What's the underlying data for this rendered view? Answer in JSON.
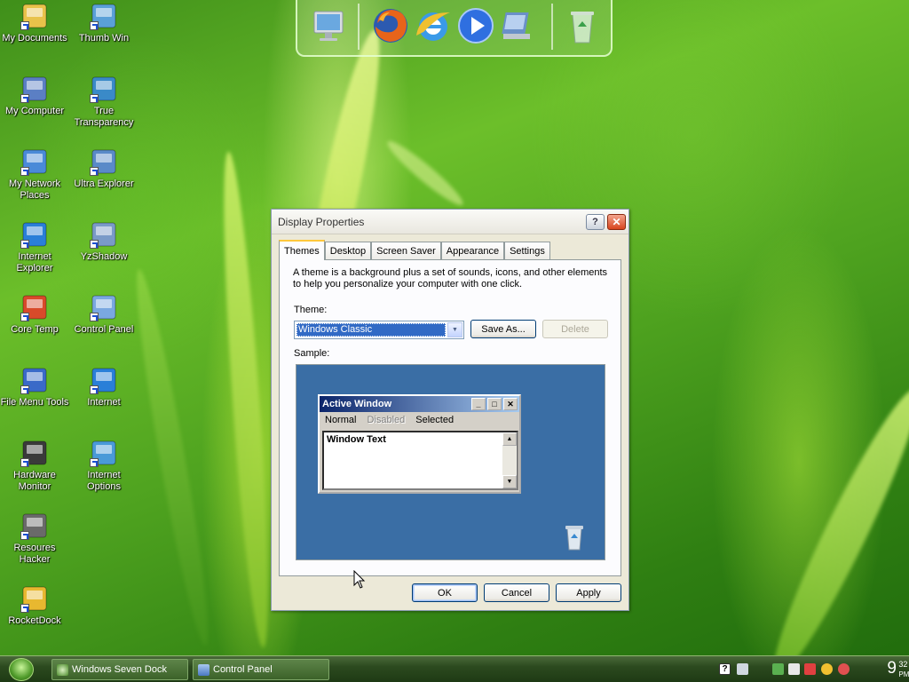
{
  "desktop": {
    "icons_left": [
      {
        "label": "My Documents",
        "icon": "folder-documents-icon",
        "color": "#e8c24a"
      },
      {
        "label": "My Computer",
        "icon": "computer-icon",
        "color": "#5b7fc4"
      },
      {
        "label": "My Network Places",
        "icon": "network-icon",
        "color": "#4a8ad8"
      },
      {
        "label": "Internet Explorer",
        "icon": "internet-explorer-icon",
        "color": "#2a7fd8"
      },
      {
        "label": "Core Temp",
        "icon": "thermometer-icon",
        "color": "#d84a2a"
      },
      {
        "label": "File Menu Tools",
        "icon": "file-menu-icon",
        "color": "#3a6ac8"
      },
      {
        "label": "Hardware Monitor",
        "icon": "hardware-monitor-icon",
        "color": "#3a3a3a"
      },
      {
        "label": "Resoures Hacker",
        "icon": "resource-hacker-icon",
        "color": "#6a6a6a"
      },
      {
        "label": "RocketDock",
        "icon": "rocketdock-icon",
        "color": "#e8b830"
      }
    ],
    "icons_right": [
      {
        "label": "Thumb Win",
        "icon": "landscape-icon",
        "color": "#5aa0d8"
      },
      {
        "label": "True Transparency",
        "icon": "true-transparency-icon",
        "color": "#3a8ac8"
      },
      {
        "label": "Ultra Explorer",
        "icon": "ultra-explorer-icon",
        "color": "#5a8ac8"
      },
      {
        "label": "YzShadow",
        "icon": "yzshadow-icon",
        "color": "#7a9ac8"
      },
      {
        "label": "Control Panel",
        "icon": "control-panel-icon",
        "color": "#7aa8e0"
      },
      {
        "label": "Internet",
        "icon": "internet-explorer-icon",
        "color": "#2a7fd8"
      },
      {
        "label": "Internet Options",
        "icon": "internet-options-icon",
        "color": "#4a9ad8"
      }
    ]
  },
  "dock": {
    "items": [
      "monitor-icon",
      "firefox-icon",
      "internet-explorer-icon",
      "media-player-icon",
      "control-panel-icon",
      "recycle-bin-icon"
    ]
  },
  "dialog": {
    "title": "Display Properties",
    "help_label": "?",
    "close_label": "✕",
    "tabs": [
      "Themes",
      "Desktop",
      "Screen Saver",
      "Appearance",
      "Settings"
    ],
    "description": "A theme is a background plus a set of sounds, icons, and other elements to help you personalize your computer with one click.",
    "theme_label": "Theme:",
    "theme_value": "Windows Classic",
    "save_as_label": "Save As...",
    "delete_label": "Delete",
    "sample_label": "Sample:",
    "sample": {
      "window_title": "Active Window",
      "menu": [
        "Normal",
        "Disabled",
        "Selected"
      ],
      "window_text": "Window Text"
    },
    "ok_label": "OK",
    "cancel_label": "Cancel",
    "apply_label": "Apply"
  },
  "taskbar": {
    "tasks": [
      "Windows Seven Dock",
      "Control Panel"
    ],
    "clock_hour": "9",
    "clock_minutes": "32",
    "clock_period": "PM"
  }
}
